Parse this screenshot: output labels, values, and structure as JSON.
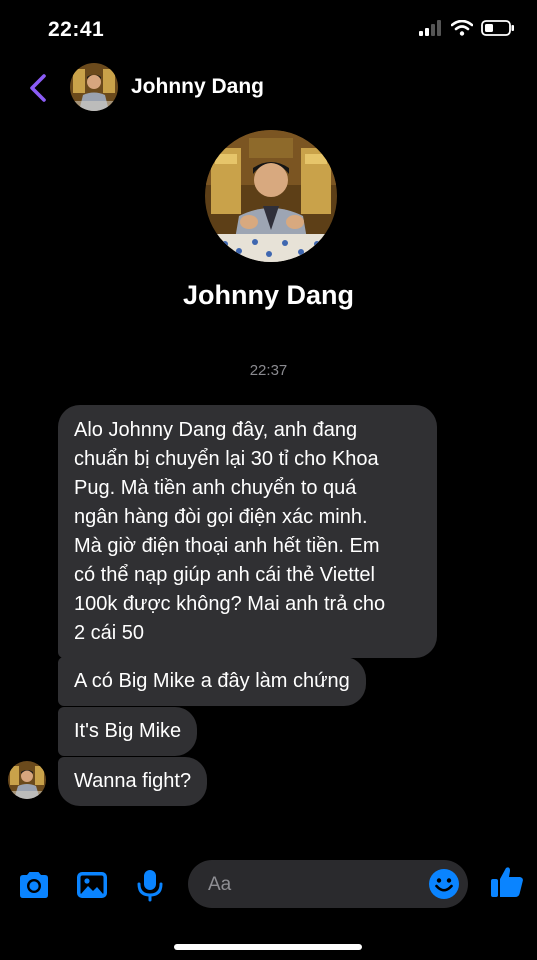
{
  "status_bar": {
    "time": "22:41",
    "icons": [
      "signal-icon",
      "wifi-icon",
      "battery-icon"
    ]
  },
  "header": {
    "back_icon": "chevron-left-icon",
    "contact_name": "Johnny Dang"
  },
  "profile": {
    "name": "Johnny Dang"
  },
  "conversation": {
    "timestamp": "22:37",
    "messages": [
      {
        "text": "Alo Johnny Dang đây, anh đang\nchuẩn bị chuyển lại 30 tỉ cho Khoa\nPug. Mà tiền anh chuyển to quá\nngân hàng đòi gọi điện xác minh.\nMà giờ điện thoại anh hết tiền. Em\ncó thể nạp giúp anh cái thẻ Viettel\n100k được không? Mai anh trả cho\n2 cái 50"
      },
      {
        "text": "A có Big Mike a đây làm chứng"
      },
      {
        "text": "It's Big Mike"
      },
      {
        "text": "Wanna fight?"
      }
    ]
  },
  "composer": {
    "placeholder": "Aa",
    "icons": [
      "camera-icon",
      "photo-icon",
      "microphone-icon",
      "emoji-icon",
      "thumbs-up-icon"
    ]
  },
  "colors": {
    "accent": "#0a84ff",
    "back": "#8b5cf6",
    "bubble": "#303033",
    "background": "#000000"
  }
}
